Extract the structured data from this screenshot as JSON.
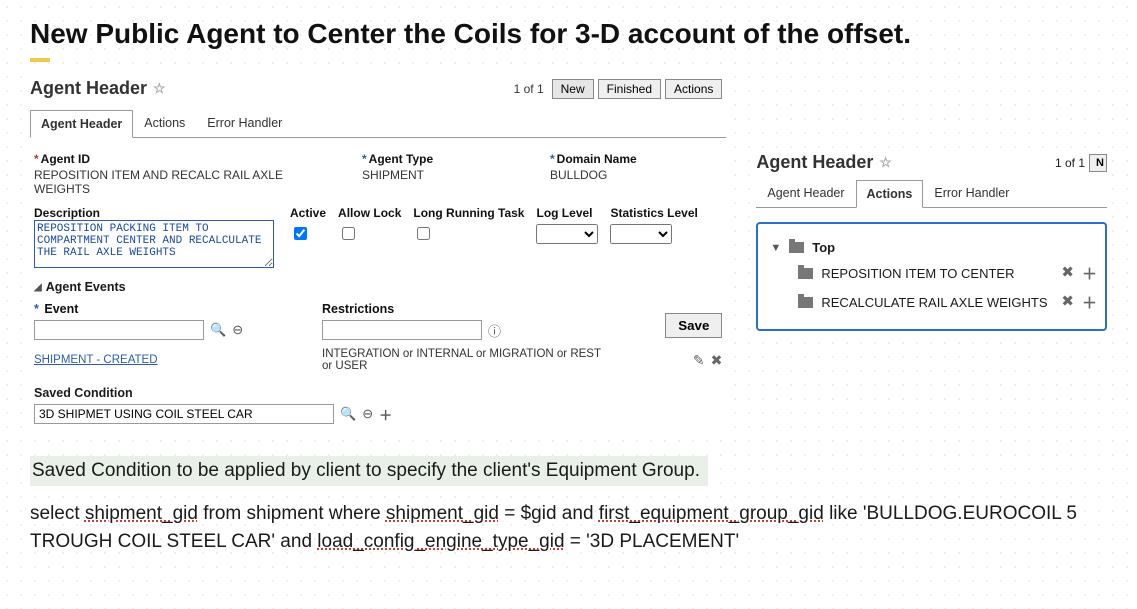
{
  "title": "New Public Agent to Center the Coils for 3-D account of the offset.",
  "left": {
    "panel_title": "Agent Header",
    "count": "1 of 1",
    "buttons": {
      "new": "New",
      "finished": "Finished",
      "actions": "Actions"
    },
    "tabs": {
      "agent_header": "Agent Header",
      "actions": "Actions",
      "error_handler": "Error Handler"
    },
    "fields": {
      "agent_id_label": "Agent ID",
      "agent_id_value": "REPOSITION ITEM AND RECALC RAIL AXLE WEIGHTS",
      "agent_type_label": "Agent Type",
      "agent_type_value": "SHIPMENT",
      "domain_label": "Domain Name",
      "domain_value": "BULLDOG",
      "description_label": "Description",
      "description_value": "REPOSITION PACKING ITEM TO COMPARTMENT CENTER AND RECALCULATE THE RAIL AXLE WEIGHTS",
      "active_label": "Active",
      "allow_lock_label": "Allow Lock",
      "long_running_label": "Long Running Task",
      "log_level_label": "Log Level",
      "stats_level_label": "Statistics Level"
    },
    "events": {
      "section": "Agent Events",
      "event_label": "Event",
      "restrictions_label": "Restrictions",
      "save": "Save",
      "link": "SHIPMENT - CREATED",
      "restrict_text": "INTEGRATION or INTERNAL or MIGRATION or REST or USER"
    },
    "saved": {
      "label": "Saved Condition",
      "value": "3D SHIPMET USING COIL STEEL CAR"
    }
  },
  "right": {
    "panel_title": "Agent Header",
    "count": "1 of 1",
    "nbtn": "N",
    "tabs": {
      "agent_header": "Agent Header",
      "actions": "Actions",
      "error_handler": "Error Handler"
    },
    "tree": {
      "top": "Top",
      "c1": "REPOSITION ITEM TO CENTER",
      "c2": "RECALCULATE RAIL AXLE WEIGHTS"
    }
  },
  "bottom": {
    "hl": "Saved Condition to be applied by client to specify the client's  Equipment Group.",
    "sql_p1": "select ",
    "sql_u1": "shipment_gid",
    "sql_p2": " from shipment where ",
    "sql_u2": "shipment_gid",
    "sql_p3": " = $gid and ",
    "sql_u3": "first_equipment_group_gid",
    "sql_p4": " like 'BULLDOG.EUROCOIL 5 TROUGH COIL STEEL CAR' and ",
    "sql_u4": "load_config_engine_type_gid",
    "sql_p5": " = '3D PLACEMENT'"
  }
}
